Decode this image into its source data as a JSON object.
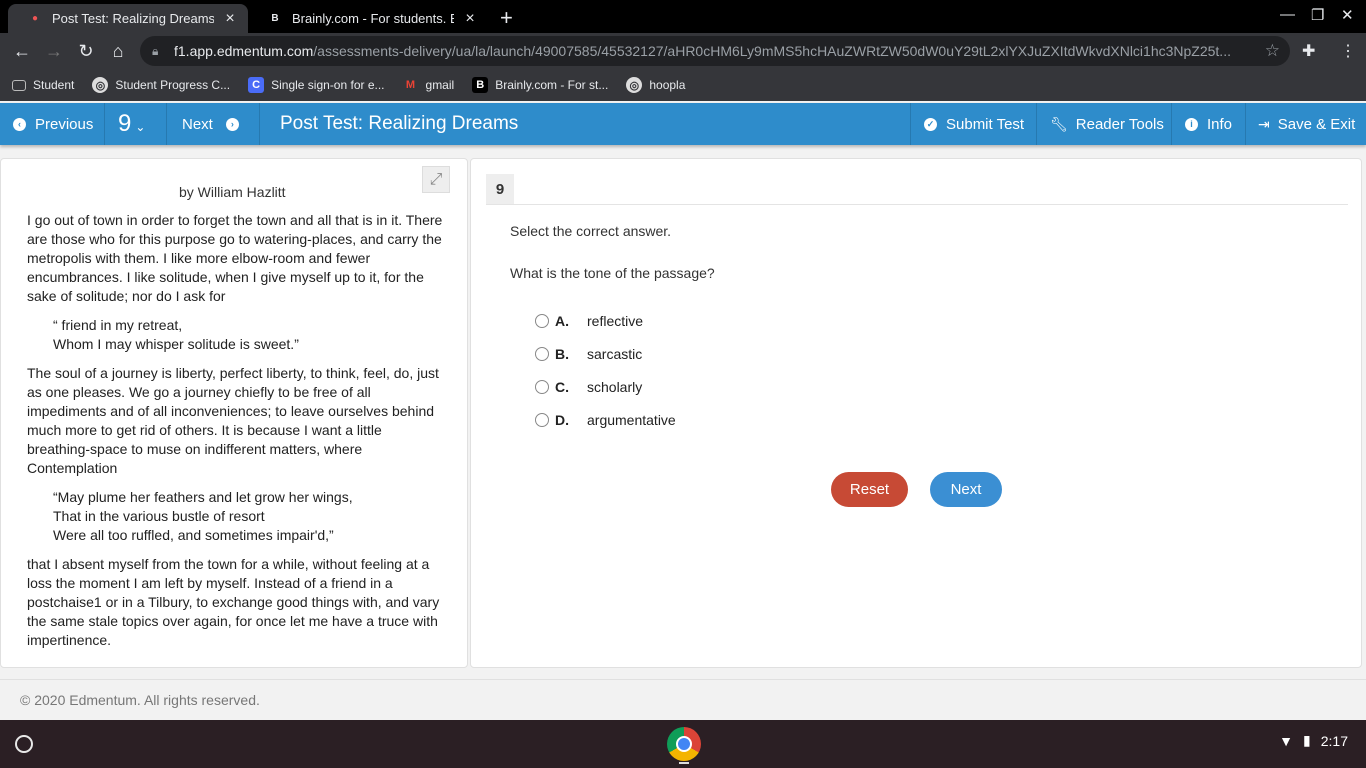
{
  "browser": {
    "tabs": [
      {
        "title": "Post Test: Realizing Dreams",
        "active": true,
        "favicon": "edmentum-favicon"
      },
      {
        "title": "Brainly.com - For students. By st",
        "active": false,
        "favicon": "brainly-favicon"
      }
    ],
    "url_host": "f1.app.edmentum.com",
    "url_path": "/assessments-delivery/ua/la/launch/49007585/45532127/aHR0cHM6Ly9mMS5hcHAuZWRtZW50dW0uY29tL2xlYXJuZXItdWkvdXNlci1hc3NpZ25t...",
    "bookmarks": [
      {
        "label": "Student",
        "icon": "folder-icon"
      },
      {
        "label": "Student Progress C...",
        "icon": "globe-icon"
      },
      {
        "label": "Single sign-on for e...",
        "icon": "clever-icon"
      },
      {
        "label": "gmail",
        "icon": "gmail-icon"
      },
      {
        "label": "Brainly.com - For st...",
        "icon": "brainly-icon"
      },
      {
        "label": "hoopla",
        "icon": "globe-icon"
      }
    ]
  },
  "appbar": {
    "previous_label": "Previous",
    "question_number": "9",
    "next_label": "Next",
    "title": "Post Test: Realizing Dreams",
    "submit_label": "Submit Test",
    "reader_tools_label": "Reader Tools",
    "info_label": "Info",
    "save_exit_label": "Save & Exit"
  },
  "passage": {
    "author": "by William Hazlitt",
    "p1": "I go out of town in order to forget the town and all that is in it. There are those who for this purpose go to watering-places, and carry the metropolis with them. I like more elbow-room and fewer encumbrances. I like solitude, when I give myself up to it, for the sake of solitude; nor do I ask for",
    "v1a": "“ friend in my retreat,",
    "v1b": "Whom I may whisper solitude is sweet.”",
    "p2": "The soul of a journey is liberty, perfect liberty, to think, feel, do, just as one pleases. We go a journey chiefly to be free of all impediments and of all inconveniences; to leave ourselves behind much more to get rid of others. It is because I want a little breathing-space to muse on indifferent matters, where Contemplation",
    "v2a": "“May plume her feathers and let grow her wings,",
    "v2b": "That in the various bustle of resort",
    "v2c": "Were all too ruffled, and sometimes impair'd,”",
    "p3": "that I absent myself from the town for a while, without feeling at a loss the moment I am left by myself. Instead of a friend in a postchaise1 or in a Tilbury, to exchange good things with, and vary the same stale topics over again, for once let me have a truce with impertinence."
  },
  "question": {
    "number": "9",
    "instruction": "Select the correct answer.",
    "text": "What is the tone of the passage?",
    "options": [
      {
        "letter": "A.",
        "text": "reflective"
      },
      {
        "letter": "B.",
        "text": "sarcastic"
      },
      {
        "letter": "C.",
        "text": "scholarly"
      },
      {
        "letter": "D.",
        "text": "argumentative"
      }
    ],
    "reset_label": "Reset",
    "next_label": "Next"
  },
  "footer": {
    "copyright": "© 2020 Edmentum. All rights reserved."
  },
  "shelf": {
    "time": "2:17"
  },
  "colors": {
    "appbar": "#2e8ccb",
    "reset": "#c74a35",
    "next": "#3b8fd3"
  }
}
